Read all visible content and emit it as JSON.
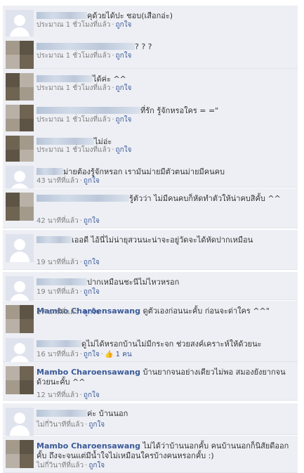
{
  "like_label": "ถูกใจ",
  "comments": [
    {
      "name": "",
      "text": "คุด้วยได้ปะ ชอบ(เสือกอ่ะ)",
      "time": "ประมาณ 1 ชั่วโมงที่แล้ว",
      "avatar": "blank",
      "likes": ""
    },
    {
      "name": "",
      "text": "? ? ?",
      "time": "ประมาณ 1 ชั่วโมงที่แล้ว",
      "avatar": "photo",
      "likes": ""
    },
    {
      "name": "",
      "text": "ได้ค่ะ ^^",
      "time": "ประมาณ 1 ชั่วโมงที่แล้ว",
      "avatar": "photo",
      "likes": ""
    },
    {
      "name": "",
      "text": "ที่รัก รู้จักหรอใคร = =\"",
      "time": "ประมาณ 1 ชั่วโมงที่แล้ว",
      "avatar": "photo",
      "likes": ""
    },
    {
      "name": "",
      "text": "ไม่อ่ะ",
      "time": "ประมาณ 1 ชั่วโมงที่แล้ว",
      "avatar": "photo",
      "likes": ""
    },
    {
      "name": "",
      "text": "ม่ายต้องรู้จักหรอก เรามันม่ายมีตัวตนม่ายมีคนคบ",
      "time": "43 นาทีที่แล้ว",
      "avatar": "blank",
      "likes": ""
    },
    {
      "name": "",
      "text": "รู้ตัวว่า ไม่มีคนคบก็หัดทำตัวให้น่าคบสิคั้บ ^^",
      "time": "42 นาทีที่แล้ว",
      "avatar": "photo",
      "likes": ""
    },
    {
      "name": "",
      "text": "เออดี ไอ้นี่ไม่น่ายุสวนนะน่าจะอยู่วัดจะได้หัดปากเหมือน",
      "time": "19 นาทีที่แล้ว",
      "avatar": "blank",
      "likes": ""
    },
    {
      "name": "",
      "text": "ปากเหมือนชะนีไม่ไหวหรอก",
      "time": "19 นาทีที่แล้ว",
      "avatar": "blank",
      "likes": ""
    },
    {
      "name": "Mambo Charoensawang",
      "text": "ดูตัวเองก่อนนะคั้บ ก่อนจะด่าใคร ^^\"",
      "time": "17 นาทีที่แล้ว",
      "avatar": "photo",
      "likes": ""
    },
    {
      "name": "",
      "text": "ดูไม่ได้หรอกบ้านไม่มีกระจก ช่วยสงค์เคราะห์ให้ด้วยนะ",
      "time": "16 นาทีที่แล้ว",
      "avatar": "blank",
      "likes": "1 คน"
    },
    {
      "name": "Mambo Charoensawang",
      "text": "บ้านยากจนอย่างเดียวไม่พอ สมองยังยากจนด้วยนะคั้บ ^^",
      "time": "12 นาทีที่แล้ว",
      "avatar": "photo",
      "likes": ""
    },
    {
      "name": "",
      "text": "ค่ะ บ้านนอก",
      "time": "ไม่กี่วินาทีที่แล้ว",
      "avatar": "blank",
      "likes": ""
    },
    {
      "name": "Mambo Charoensawang",
      "text": "ไม่ได้ว่าบ้านนอกคั้บ คนบ้านนอกก็นิสัยดีออกคั้บ ถึงจะจนแต่มีน้ำใจไม่เหมือนใครบ้างคนหรอกคั้บ :)",
      "time": "ไม่กี่วินาทีที่แล้ว",
      "avatar": "photo",
      "likes": ""
    }
  ]
}
